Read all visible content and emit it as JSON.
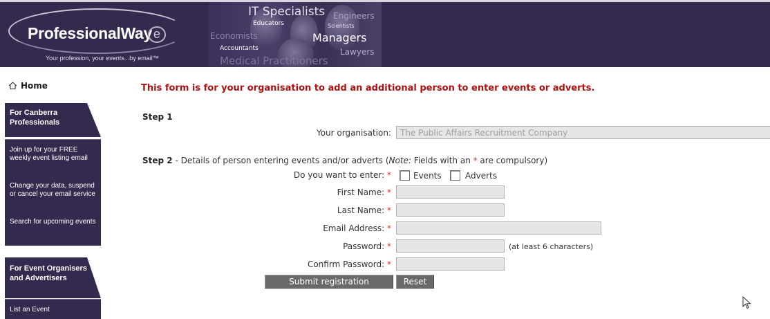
{
  "banner": {
    "logo_text": "ProfessionalWay",
    "logo_badge": "e",
    "tagline": "Your profession, your events...by email™",
    "collage_words": [
      "IT Specialists",
      "Engineers",
      "Educators",
      "Scientists",
      "Economists",
      "Managers",
      "Accountants",
      "Lawyers",
      "Medical Practitioners"
    ]
  },
  "sidebar": {
    "home_label": "Home",
    "home_icon": "home-icon",
    "section1_heading": "For Canberra Professionals",
    "section1_links": [
      "Join up for your FREE weekly event listing email",
      "Change your data, suspend or cancel your email service",
      "Search for upcoming events"
    ],
    "section2_heading": "For Event Organisers and Advertisers",
    "section2_links": [
      "List an Event"
    ]
  },
  "form": {
    "title": "This form is for your organisation to add an additional person to enter events or adverts.",
    "step1_label": "Step 1",
    "organisation_label": "Your organisation:",
    "organisation_value": "The Public Affairs Recruitment Company",
    "step2_label": "Step 2",
    "step2_text_a": " - Details of person entering events and/or adverts (",
    "step2_note": "Note:",
    "step2_text_b": " Fields with an ",
    "step2_star": "*",
    "step2_text_c": " are compulsory)",
    "enter_label": "Do you want to enter:",
    "events_label": "Events",
    "adverts_label": "Adverts",
    "first_name_label": "First Name:",
    "last_name_label": "Last Name:",
    "email_label": "Email Address:",
    "password_label": "Password:",
    "password_hint": "(at least 6 characters)",
    "confirm_password_label": "Confirm Password:",
    "required_marker": "*",
    "first_name_value": "",
    "last_name_value": "",
    "email_value": "",
    "password_value": "",
    "confirm_password_value": "",
    "events_checked": false,
    "adverts_checked": false,
    "submit_label": "Submit registration",
    "reset_label": "Reset"
  },
  "colors": {
    "brand_purple": "#342a4e",
    "title_red": "#b01010",
    "required_red": "#e0302a",
    "button_grey": "#6a6a6a"
  }
}
